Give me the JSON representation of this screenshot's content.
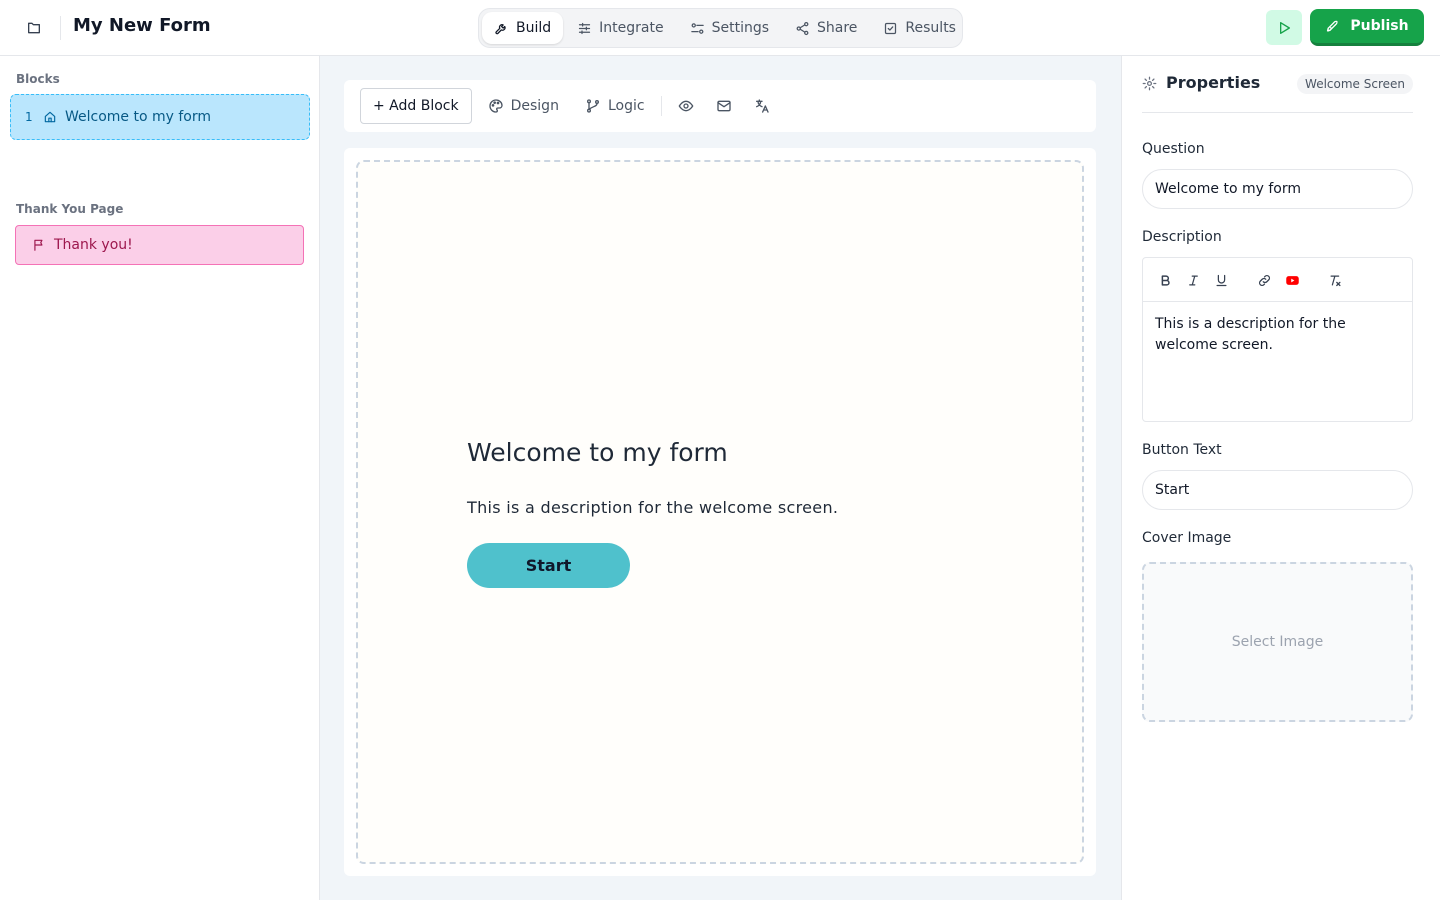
{
  "header": {
    "title": "My New Form",
    "folder_icon": "folder-icon",
    "nav": [
      {
        "label": "Build",
        "icon": "wrench-icon",
        "active": true
      },
      {
        "label": "Integrate",
        "icon": "sliders-icon"
      },
      {
        "label": "Settings",
        "icon": "settings-sliders-icon"
      },
      {
        "label": "Share",
        "icon": "share-icon"
      },
      {
        "label": "Results",
        "icon": "checkbox-icon"
      }
    ],
    "publish_label": "Publish",
    "colors": {
      "publish": "#16a34a",
      "preview_bg": "#d1fae5"
    }
  },
  "sidebar": {
    "blocks_label": "Blocks",
    "blocks": [
      {
        "number": "1",
        "label": "Welcome to my form",
        "icon": "home-icon"
      }
    ],
    "thankyou_label": "Thank You Page",
    "thankyou_item": {
      "label": "Thank you!",
      "icon": "flag-icon"
    },
    "colors": {
      "welcome_bg": "#bae6fd",
      "thankyou_bg": "#fbcfe8"
    }
  },
  "toolbar": {
    "add_block": "+ Add Block",
    "design": "Design",
    "logic": "Logic",
    "icons": [
      "eye-icon",
      "mail-icon",
      "translate-icon"
    ]
  },
  "canvas": {
    "title": "Welcome to my form",
    "description": "This is a description for the welcome screen.",
    "button": "Start",
    "button_color": "#4fc1cc"
  },
  "properties": {
    "title": "Properties",
    "badge": "Welcome Screen",
    "question_label": "Question",
    "question_value": "Welcome to my form",
    "description_label": "Description",
    "description_value": "This is a description for the welcome screen.",
    "button_text_label": "Button Text",
    "button_text_value": "Start",
    "cover_image_label": "Cover Image",
    "select_image": "Select Image"
  }
}
